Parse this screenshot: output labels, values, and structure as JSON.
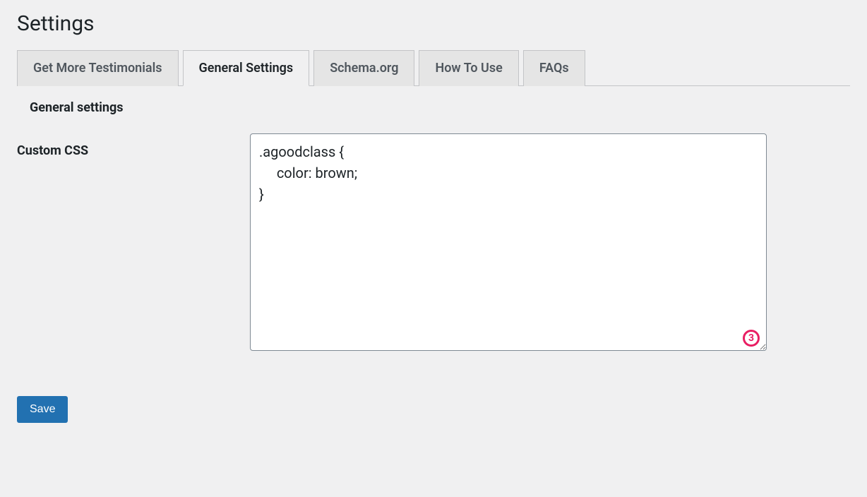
{
  "pageTitle": "Settings",
  "tabs": [
    {
      "label": "Get More Testimonials",
      "active": false
    },
    {
      "label": "General Settings",
      "active": true
    },
    {
      "label": "Schema.org",
      "active": false
    },
    {
      "label": "How To Use",
      "active": false
    },
    {
      "label": "FAQs",
      "active": false
    }
  ],
  "sectionHeading": "General settings",
  "form": {
    "customCssLabel": "Custom CSS",
    "customCssValue": ".agoodclass {\n     color: brown;\n}"
  },
  "annotationBadge": "3",
  "saveButtonLabel": "Save"
}
